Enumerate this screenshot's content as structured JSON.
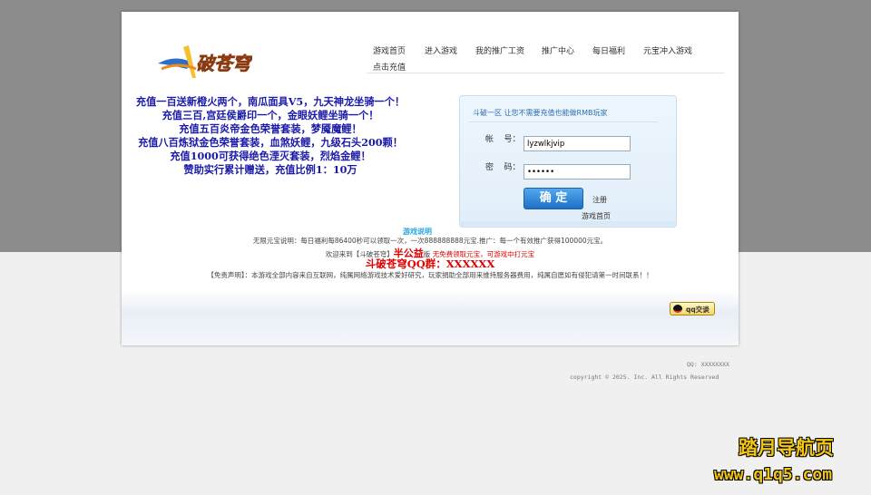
{
  "nav": {
    "items": [
      "游戏首页",
      "进入游戏",
      "我的推广工资",
      "推广中心",
      "每日福利",
      "元宝冲入游戏",
      "点击充值"
    ]
  },
  "promo": {
    "lines": [
      "充值一百送新橙火两个，南瓜面具V5，九天神龙坐骑一个！",
      "充值三百,宫廷侯爵印一个，金眼妖鲤坐骑一个！",
      "充值五百炎帝金色荣誉套装，梦魇魔鲤！",
      "充值八百炼狱金色荣誉套装，血煞妖鲤，九级石头200颗！",
      "充值1000可获得绝色湮灭套装，烈焰金鲤！",
      "赞助实行累计赠送，充值比例1：10万"
    ]
  },
  "login": {
    "title": "斗破一区 让您不需要充值也能做RMB玩家",
    "account_label": "帐    号：",
    "password_label": "密    码：",
    "account_value": "lyzwlkjvip",
    "password_value": "••••••",
    "submit_label": "确 定",
    "register_label": "注册",
    "home_label": "游戏首页"
  },
  "info": {
    "game_link": "游戏说明",
    "line1": "无限元宝说明：每日福利每86400秒可以领取一次，一次888888888元宝.推广：每一个有效推广获得100000元宝。",
    "line2_a": "欢迎来到【斗破苍穹】",
    "line2_b": "半公益",
    "line2_c": "版 ",
    "line2_d": "无免费领取元宝，可游戏中打元宝",
    "qq_group": "斗破苍穹QQ群：XXXXXX",
    "disclaimer": "【免责声明】：本游戏全部内容来自互联网，纯属网络游戏技术爱好研究，玩家捐助全部用来维持服务器费用，纯属自愿如有侵犯请第一时间联系！！",
    "qq_button": "qq交谈"
  },
  "footer": {
    "qq": "QQ: XXXXXXXX",
    "copyright": "copyright © 2025. Inc. All Rights Reserved"
  },
  "watermark": {
    "line1": "踏月导航页",
    "line2": "www.q1q5.com"
  }
}
